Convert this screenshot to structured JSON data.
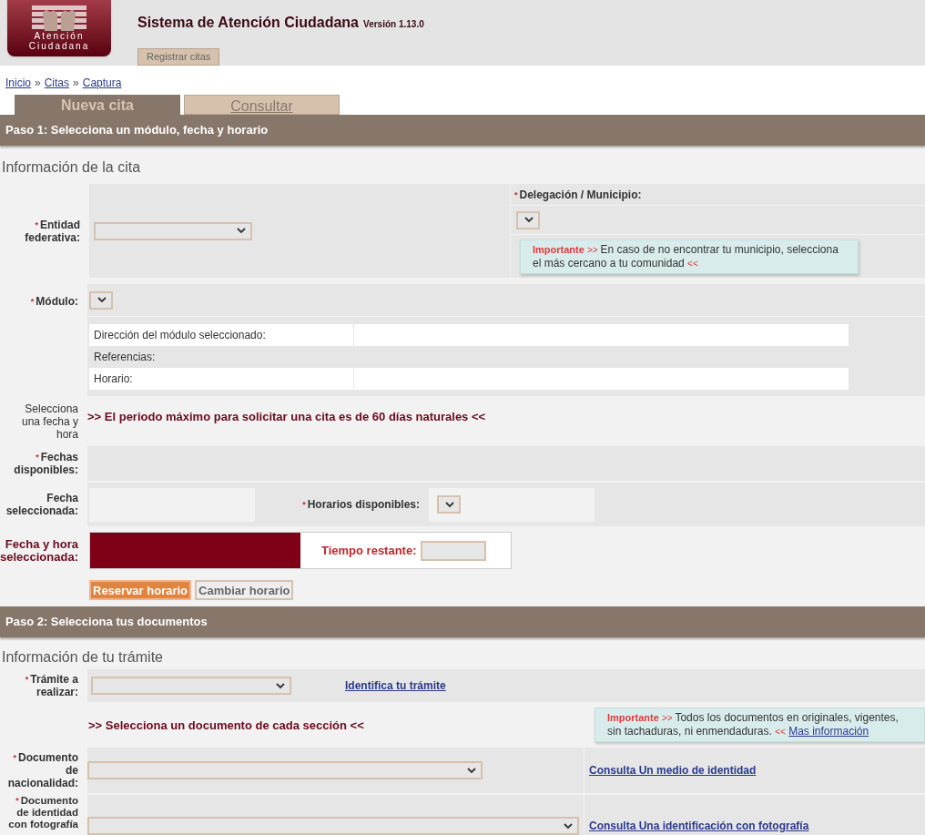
{
  "header": {
    "logo_lines": [
      "Atención",
      "Ciudadana"
    ],
    "title": "Sistema de Atención Ciudadana",
    "version": "Versión 1.13.0",
    "nav_button": "Registrar citas"
  },
  "breadcrumb": {
    "separator": "»",
    "items": [
      "Inicio",
      "Citas",
      "Captura"
    ]
  },
  "tabs": [
    {
      "label": "Nueva cita",
      "selected": true
    },
    {
      "label": "Consultar",
      "selected": false
    }
  ],
  "step1": {
    "title": "Paso 1: Selecciona un módulo, fecha y horario",
    "section": "Información de la cita",
    "entidad": {
      "label": "Entidad federativa:",
      "mark": "*"
    },
    "delegacion": {
      "label": "Delegación / Municipio:",
      "mark": "*"
    },
    "note1": {
      "label": "Importante",
      "open": ">>",
      "text": "En caso de no encontrar tu municipio, selecciona el más cercano a tu comunidad",
      "close": "<<"
    },
    "modulo": {
      "label": "Módulo:",
      "mark": "*"
    },
    "module_info": [
      "Dirección del módulo seleccionado:",
      "Referencias:",
      "Horario:"
    ],
    "selecciona": {
      "label": "Selecciona una fecha y hora",
      "message": ">> El periodo máximo para solicitar una cita es de 60 días naturales <<"
    },
    "fechas": {
      "label": "Fechas disponibles:",
      "mark": "*"
    },
    "fecha_sel": {
      "label": "Fecha seleccionada:"
    },
    "horarios": {
      "label": "Horarios disponibles:",
      "mark": "*"
    },
    "fecha_hora": {
      "label": "Fecha y hora seleccionada:",
      "timer_label": "Tiempo restante:"
    },
    "buttons": [
      {
        "label": "Reservar horario",
        "kind": "primary"
      },
      {
        "label": "Cambiar horario",
        "kind": "secondary"
      }
    ]
  },
  "step2": {
    "title": "Paso 2: Selecciona tus documentos",
    "section": "Información de tu trámite",
    "tramite": {
      "label": "Trámite a realizar:",
      "mark": "*",
      "link": "Identifica tu trámite"
    },
    "message": ">> Selecciona un documento de cada sección <<",
    "note2": {
      "label": "Importante",
      "open": ">>",
      "text": "Todos los documentos en originales, vigentes, sin tachaduras, ni enmendaduras.",
      "close": "<<",
      "link": "Mas información"
    },
    "documents": [
      {
        "label": "Documento de nacionalidad:",
        "mark": "*",
        "link": "Consulta Un medio de identidad"
      },
      {
        "label": "Documento de identidad con fotografía",
        "mark": "*",
        "link": "Consulta Una identificación con fotografía"
      }
    ]
  }
}
